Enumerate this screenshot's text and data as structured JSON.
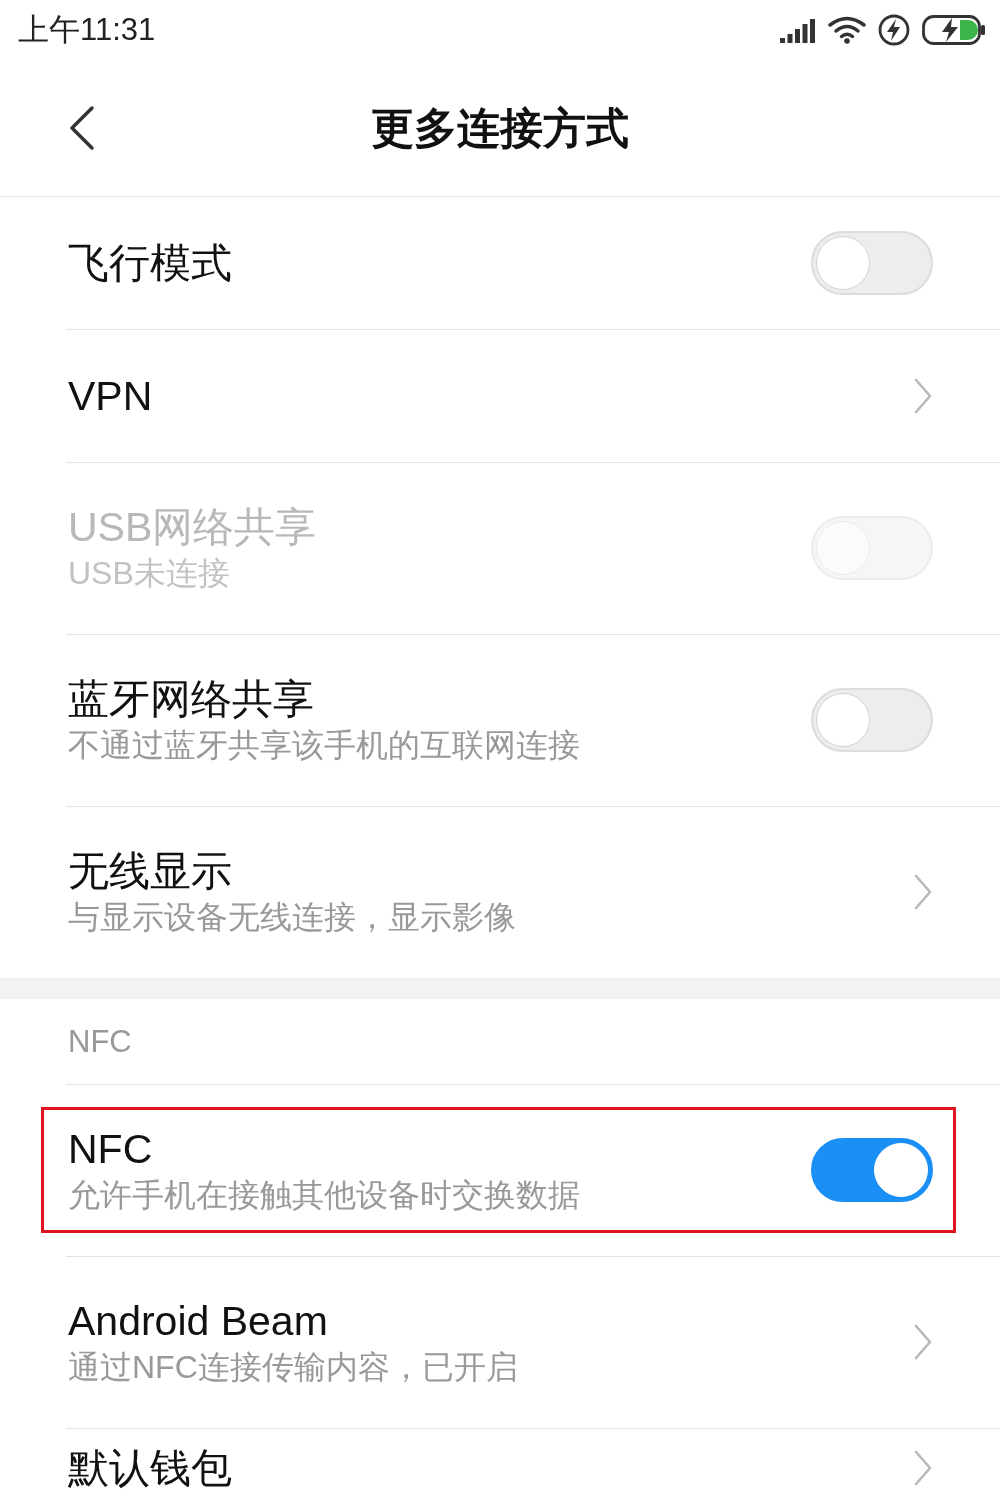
{
  "status_bar": {
    "time": "上午11:31"
  },
  "header": {
    "title": "更多连接方式"
  },
  "sections": [
    {
      "items": [
        {
          "kind": "toggle",
          "title": "飞行模式",
          "on": false,
          "disabled": false,
          "highlighted": false
        },
        {
          "kind": "link",
          "title": "VPN",
          "disabled": false,
          "highlighted": false
        },
        {
          "kind": "toggle",
          "title": "USB网络共享",
          "subtitle": "USB未连接",
          "on": false,
          "disabled": true,
          "highlighted": false
        },
        {
          "kind": "toggle",
          "title": "蓝牙网络共享",
          "subtitle": "不通过蓝牙共享该手机的互联网连接",
          "on": false,
          "disabled": false,
          "highlighted": false
        },
        {
          "kind": "link",
          "title": "无线显示",
          "subtitle": "与显示设备无线连接，显示影像",
          "disabled": false,
          "highlighted": false
        }
      ]
    },
    {
      "header": "NFC",
      "items": [
        {
          "kind": "toggle",
          "title": "NFC",
          "subtitle": "允许手机在接触其他设备时交换数据",
          "on": true,
          "disabled": false,
          "highlighted": true
        },
        {
          "kind": "link",
          "title": "Android Beam",
          "subtitle": "通过NFC连接传输内容，已开启",
          "disabled": false,
          "highlighted": false
        },
        {
          "kind": "link",
          "title": "默认钱包",
          "disabled": false,
          "highlighted": false
        }
      ]
    }
  ]
}
